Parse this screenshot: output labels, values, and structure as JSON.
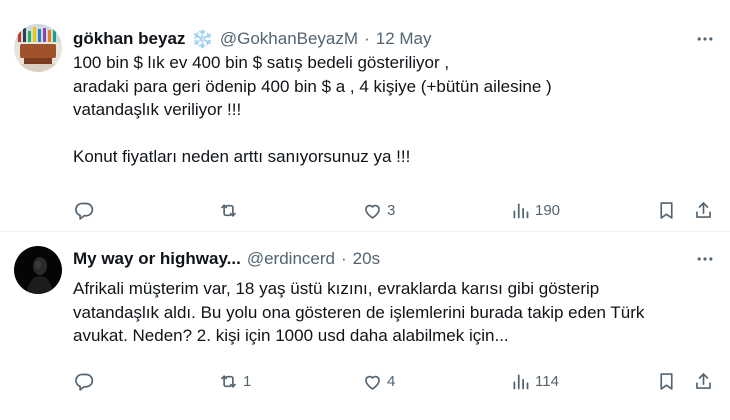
{
  "tweets": [
    {
      "author_name": "gökhan beyaz",
      "name_emoji": "❄️",
      "handle": "@GokhanBeyazM",
      "separator": "·",
      "time": "12 May",
      "text_lines": [
        "100 bin $ lık ev 400 bin $ satış bedeli gösteriliyor ,",
        "aradaki para geri ödenip 400 bin $ a , 4 kişiye (+bütün ailesine )",
        "vatandaşlık veriliyor !!!",
        "",
        "Konut fiyatları neden arttı sanıyorsunuz ya !!!"
      ],
      "replies": "",
      "retweets": "",
      "likes": "3",
      "views": "190",
      "icons": [
        "reply-icon",
        "retweet-icon",
        "like-icon",
        "views-icon",
        "bookmark-icon",
        "share-icon",
        "more-icon"
      ]
    },
    {
      "author_name": "My way or highway...",
      "handle": "@erdincerd",
      "separator": "·",
      "time": "20s",
      "text_lines": [
        "Afrikali müşterim var, 18 yaş üstü kızını, evraklarda karısı gibi gösterip",
        "vatandaşlık aldı. Bu yolu ona gösteren de işlemlerini burada takip eden Türk",
        "avukat. Neden? 2. kişi için 1000 usd daha alabilmek için..."
      ],
      "replies": "",
      "retweets": "1",
      "likes": "4",
      "views": "114",
      "icons": [
        "reply-icon",
        "retweet-icon",
        "like-icon",
        "views-icon",
        "bookmark-icon",
        "share-icon",
        "more-icon"
      ]
    }
  ],
  "colors": {
    "text": "#0f1419",
    "secondary": "#536471",
    "divider": "#eff3f4",
    "snowflake": "#4a9fd8"
  }
}
